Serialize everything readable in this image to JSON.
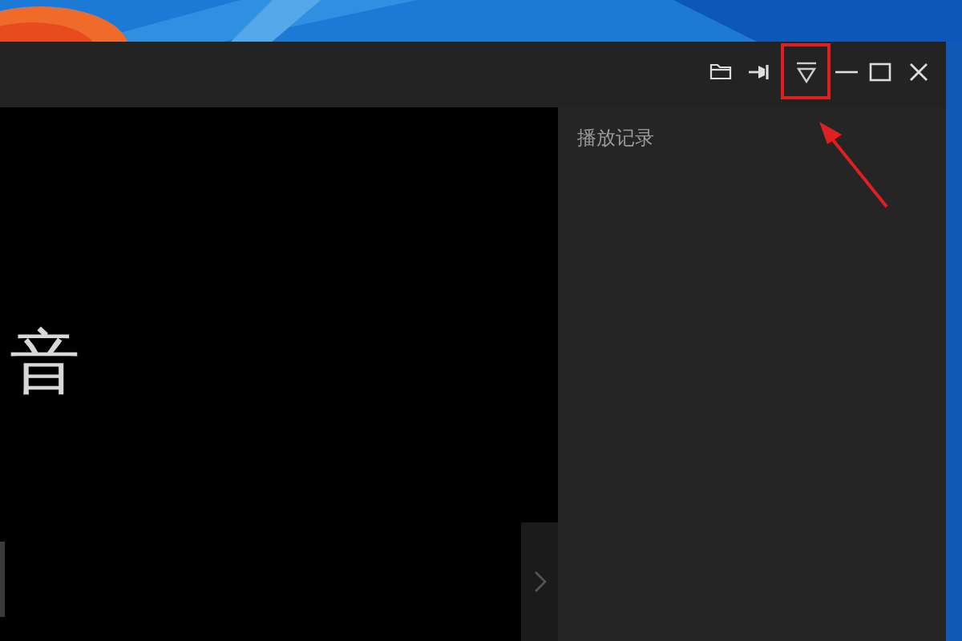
{
  "title_bar": {
    "buttons": [
      {
        "kind": "folder",
        "highlighted": false
      },
      {
        "kind": "pin",
        "highlighted": false
      },
      {
        "kind": "filter",
        "highlighted": true
      },
      {
        "kind": "minimize",
        "highlighted": false
      },
      {
        "kind": "maximize",
        "highlighted": false
      },
      {
        "kind": "close",
        "highlighted": false
      }
    ]
  },
  "video": {
    "caption": "音"
  },
  "side_panel": {
    "title": "播放记录"
  }
}
